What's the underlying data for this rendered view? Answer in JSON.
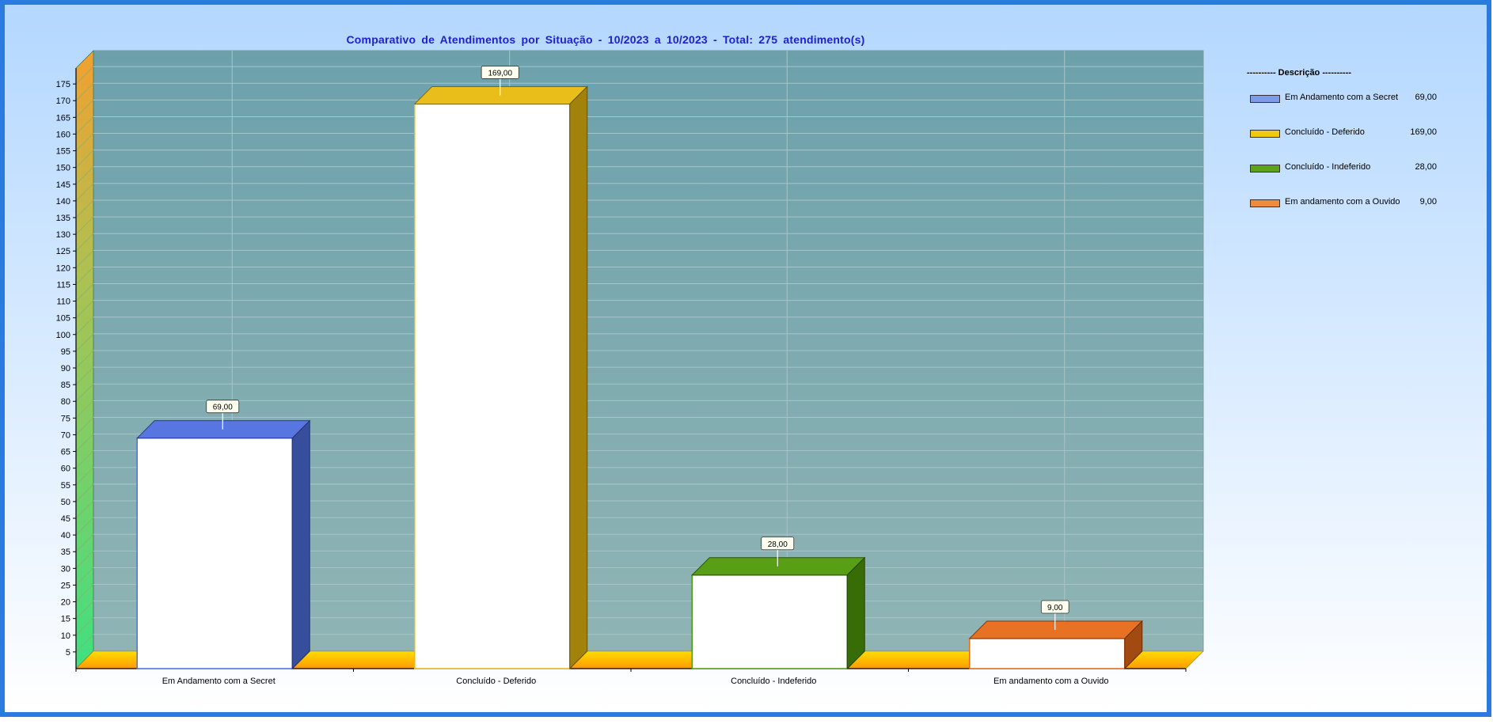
{
  "chart_data": {
    "type": "bar",
    "title": "Comparativo de Atendimentos por Situação - 10/2023 a 10/2023 - Total: 275 atendimento(s)",
    "categories": [
      "Em Andamento com a Secret",
      "Concluído - Deferido",
      "Concluído - Indeferido",
      "Em andamento com a Ouvido"
    ],
    "values": [
      69,
      169,
      28,
      9
    ],
    "value_labels": [
      "69,00",
      "169,00",
      "28,00",
      "9,00"
    ],
    "colors": [
      "#4f6fe0",
      "#e8b90e",
      "#4f9a0a",
      "#e86a18"
    ],
    "ylim": [
      0,
      180
    ],
    "yticks": [
      5,
      10,
      15,
      20,
      25,
      30,
      35,
      40,
      45,
      50,
      55,
      60,
      65,
      70,
      75,
      80,
      85,
      90,
      95,
      100,
      105,
      110,
      115,
      120,
      125,
      130,
      135,
      140,
      145,
      150,
      155,
      160,
      165,
      170,
      175
    ],
    "grid": true,
    "legend_position": "right",
    "xlabel": "",
    "ylabel": ""
  },
  "legend": {
    "title": "---------- Descrição ----------",
    "items": [
      {
        "label": "Em Andamento com a Secret",
        "value": "69,00",
        "color": "#7f9be8"
      },
      {
        "label": "Concluído - Deferido",
        "value": "169,00",
        "color": "#f0c814"
      },
      {
        "label": "Concluído - Indeferido",
        "value": "28,00",
        "color": "#5ea218"
      },
      {
        "label": "Em andamento com a Ouvido",
        "value": "9,00",
        "color": "#f08a3c"
      }
    ]
  },
  "theme": {
    "frame_border": "#2a7ae0",
    "background_top": "#b3d7ff",
    "background_bottom": "#ffffff",
    "plot_bg_top": "#6fa3ae",
    "plot_bg_bottom": "#8fb3b3",
    "title_color": "#1f1fcf"
  }
}
